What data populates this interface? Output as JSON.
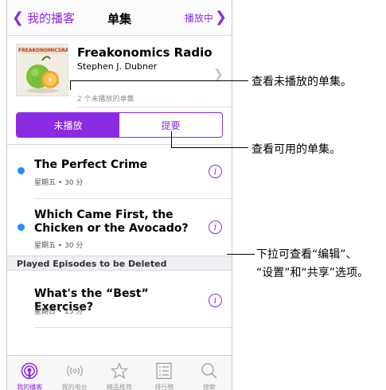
{
  "nav": {
    "back_label": "我的播客",
    "title": "单集",
    "playing_label": "播放中"
  },
  "podcast": {
    "artwork_text": "FREAKONOMICSRADIO",
    "title": "Freakonomics Radio",
    "author": "Stephen J. Dubner",
    "unplayed_count": "2 个未播放的单集"
  },
  "segments": [
    {
      "label": "未播放",
      "selected": true
    },
    {
      "label": "提要",
      "selected": false
    }
  ],
  "episodes": [
    {
      "title": "The Perfect Crime",
      "meta": "星期五 • 30 分",
      "unplayed": true
    },
    {
      "title": "Which Came First, the Chicken or the Avocado?",
      "meta": "星期五 • 30 分",
      "unplayed": true
    }
  ],
  "section_header": "Played Episodes to be Deleted",
  "played_episodes": [
    {
      "title": "What's the “Best” Exercise?",
      "meta": "星期日 • 15 分",
      "unplayed": false
    }
  ],
  "tabs": [
    {
      "label": "我的播客",
      "icon": "podcast-icon",
      "active": true
    },
    {
      "label": "我的电台",
      "icon": "radio-broadcast-icon",
      "active": false
    },
    {
      "label": "精品推荐",
      "icon": "star-icon",
      "active": false
    },
    {
      "label": "排行榜",
      "icon": "list-icon",
      "active": false
    },
    {
      "label": "搜索",
      "icon": "search-icon",
      "active": false
    }
  ],
  "callouts": {
    "unplayed": "查看未播放的单集。",
    "feed": "查看可用的单集。",
    "pull_line1": "下拉可查看“编辑”、",
    "pull_line2": "“设置”和“共享”选项。"
  },
  "colors": {
    "accent": "#8a2be2",
    "unplayed_dot": "#1e90ff"
  }
}
